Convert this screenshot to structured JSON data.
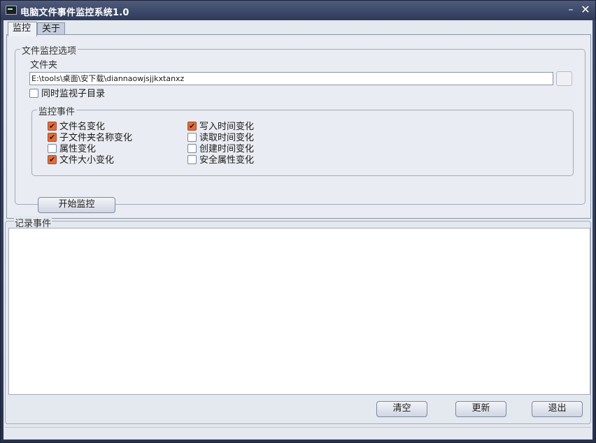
{
  "window": {
    "title": "电脑文件事件监控系统1.0",
    "minimize_glyph": "–",
    "close_glyph": "✕"
  },
  "tabs": [
    {
      "label": "监控",
      "active": true
    },
    {
      "label": "关于",
      "active": false
    }
  ],
  "options": {
    "legend": "文件监控选项",
    "folder_label": "文件夹",
    "folder_path": "E:\\tools\\桌面\\安下载\\diannaowjsjjkxtanxz",
    "subdir_label": "同时监视子目录",
    "subdir_checked": false
  },
  "events": {
    "legend": "监控事件",
    "left": [
      {
        "label": "文件名变化",
        "checked": true
      },
      {
        "label": "子文件夹名称变化",
        "checked": true
      },
      {
        "label": "属性变化",
        "checked": false
      },
      {
        "label": "文件大小变化",
        "checked": true
      }
    ],
    "right": [
      {
        "label": "写入时间变化",
        "checked": true
      },
      {
        "label": "读取时间变化",
        "checked": false
      },
      {
        "label": "创建时间变化",
        "checked": false
      },
      {
        "label": "安全属性变化",
        "checked": false
      }
    ]
  },
  "start_button": "开始监控",
  "log": {
    "legend": "记录事件",
    "content": ""
  },
  "buttons": {
    "clear": "清空",
    "refresh": "更新",
    "exit": "退出"
  },
  "colors": {
    "checked": "#e06c3c",
    "titlebar": "#3d4a6b"
  }
}
